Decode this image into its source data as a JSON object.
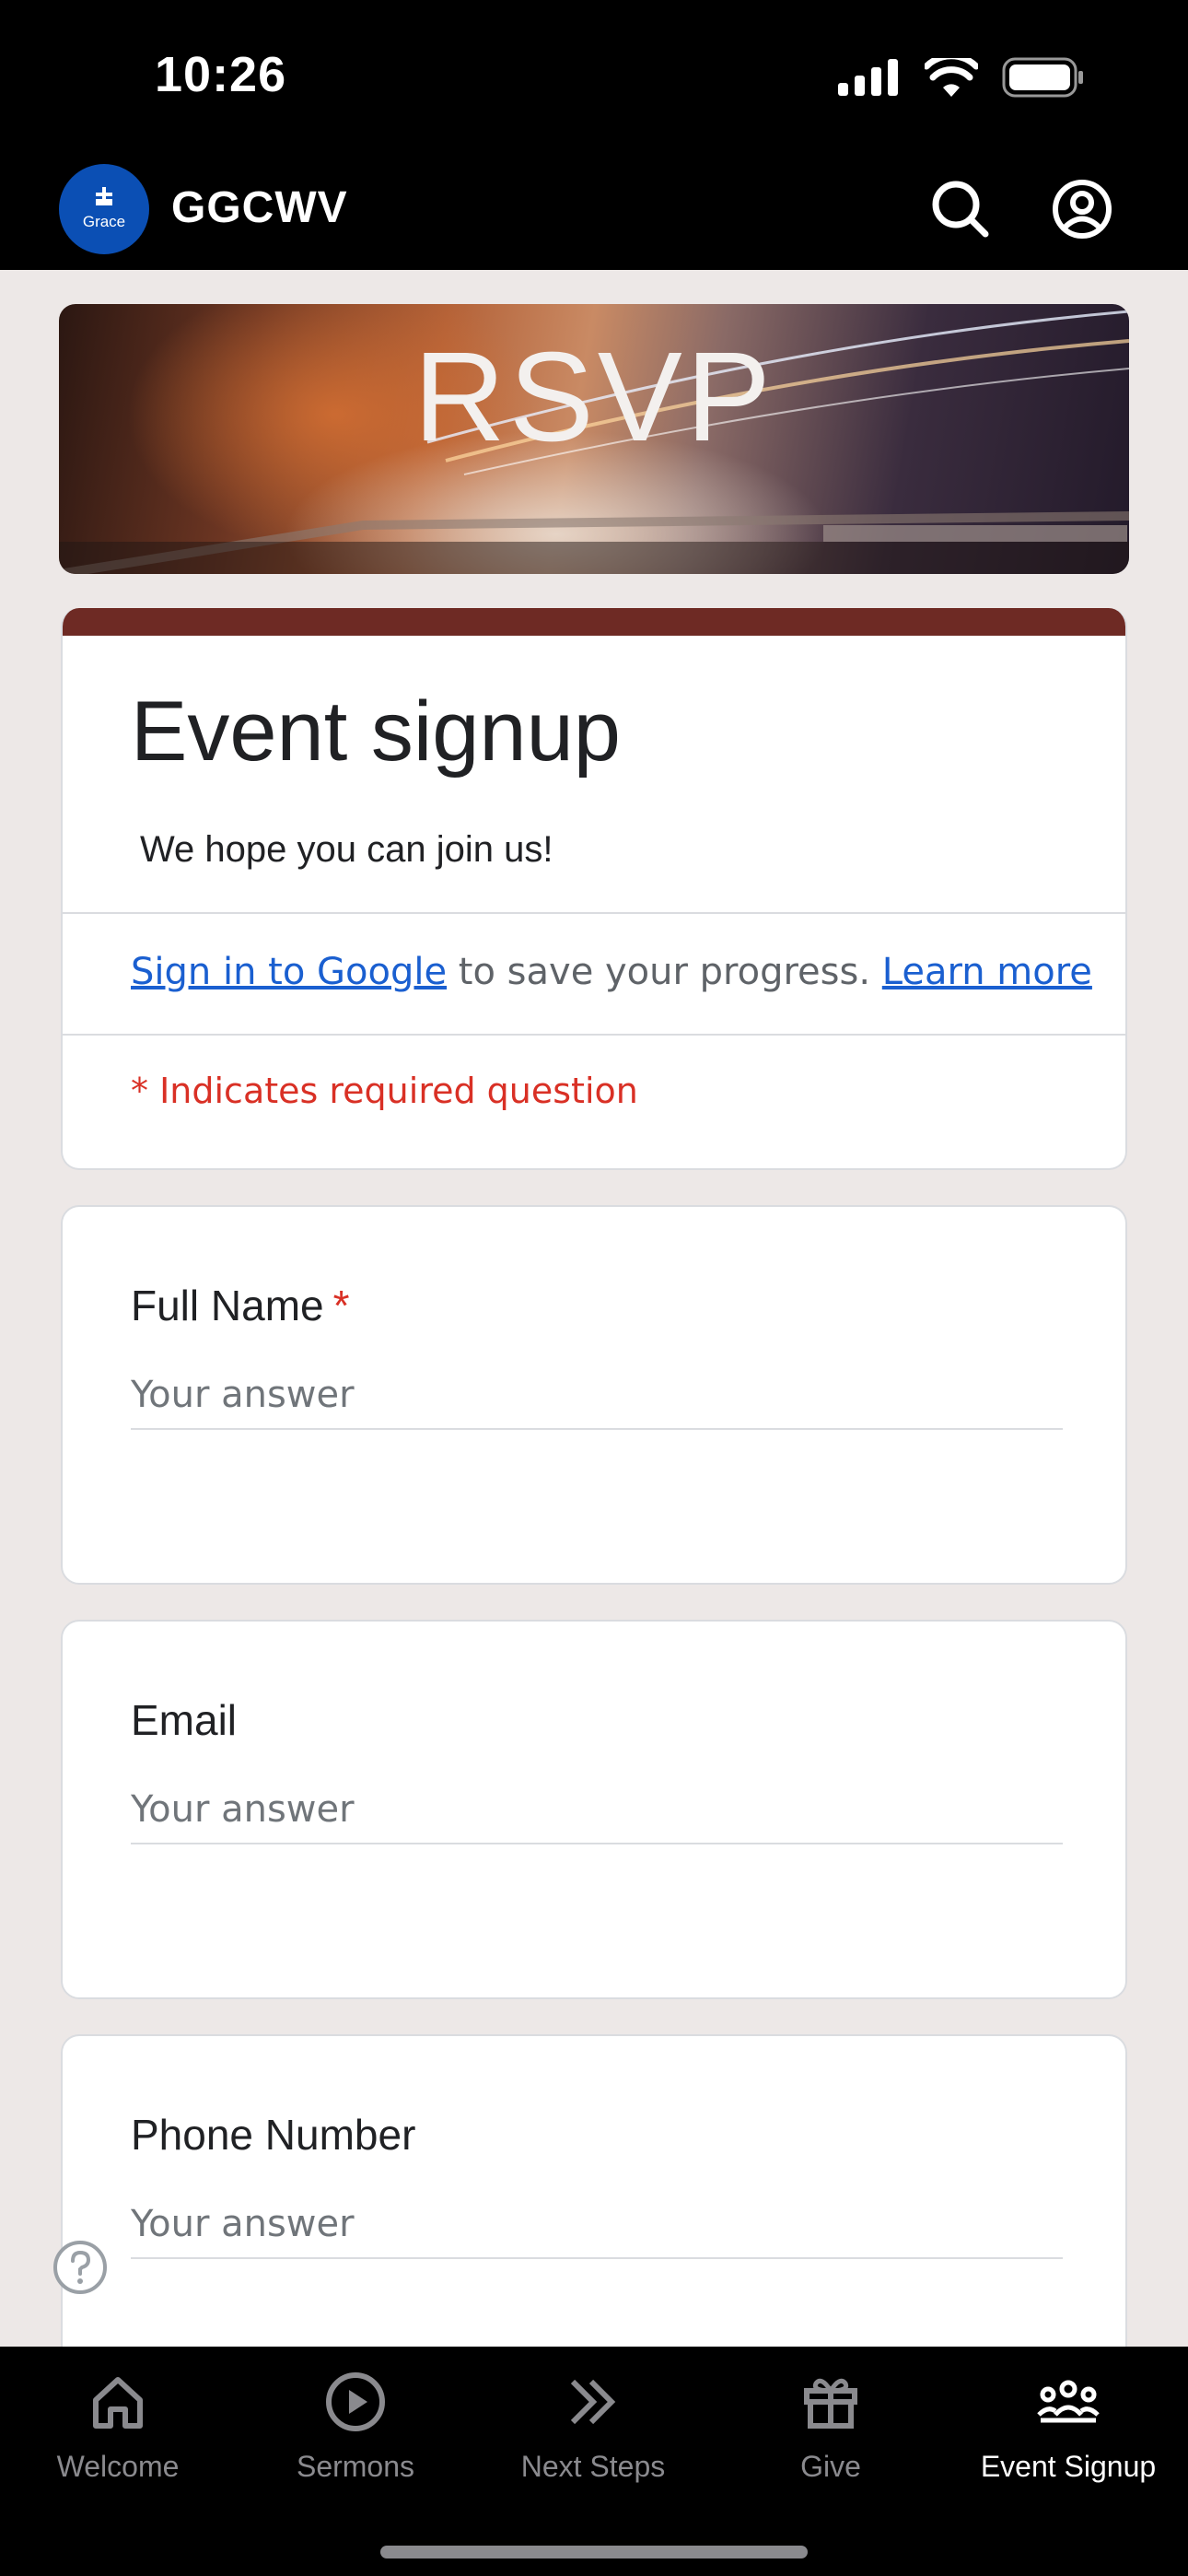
{
  "status_bar": {
    "time": "10:26"
  },
  "header": {
    "title": "GGCWV",
    "logo_text": "Grace"
  },
  "banner": {
    "title": "RSVP"
  },
  "form": {
    "title": "Event signup",
    "description": "We hope you can join us!",
    "signin_link": "Sign in to Google",
    "signin_text": " to save your progress. ",
    "learn_more": "Learn more",
    "required_note": "* Indicates required question"
  },
  "questions": [
    {
      "label": "Full Name",
      "required": "*",
      "placeholder": "Your answer"
    },
    {
      "label": "Email",
      "placeholder": "Your answer"
    },
    {
      "label": "Phone Number",
      "placeholder": "Your answer"
    }
  ],
  "tabs": [
    {
      "label": "Welcome",
      "icon": "home-icon"
    },
    {
      "label": "Sermons",
      "icon": "play-icon"
    },
    {
      "label": "Next Steps",
      "icon": "chevrons-right-icon"
    },
    {
      "label": "Give",
      "icon": "gift-icon"
    },
    {
      "label": "Event Signup",
      "icon": "people-icon"
    }
  ],
  "colors": {
    "accent": "#6e2a24",
    "link": "#1a5fd0",
    "required": "#d93025",
    "logo": "#0b4fb4"
  }
}
